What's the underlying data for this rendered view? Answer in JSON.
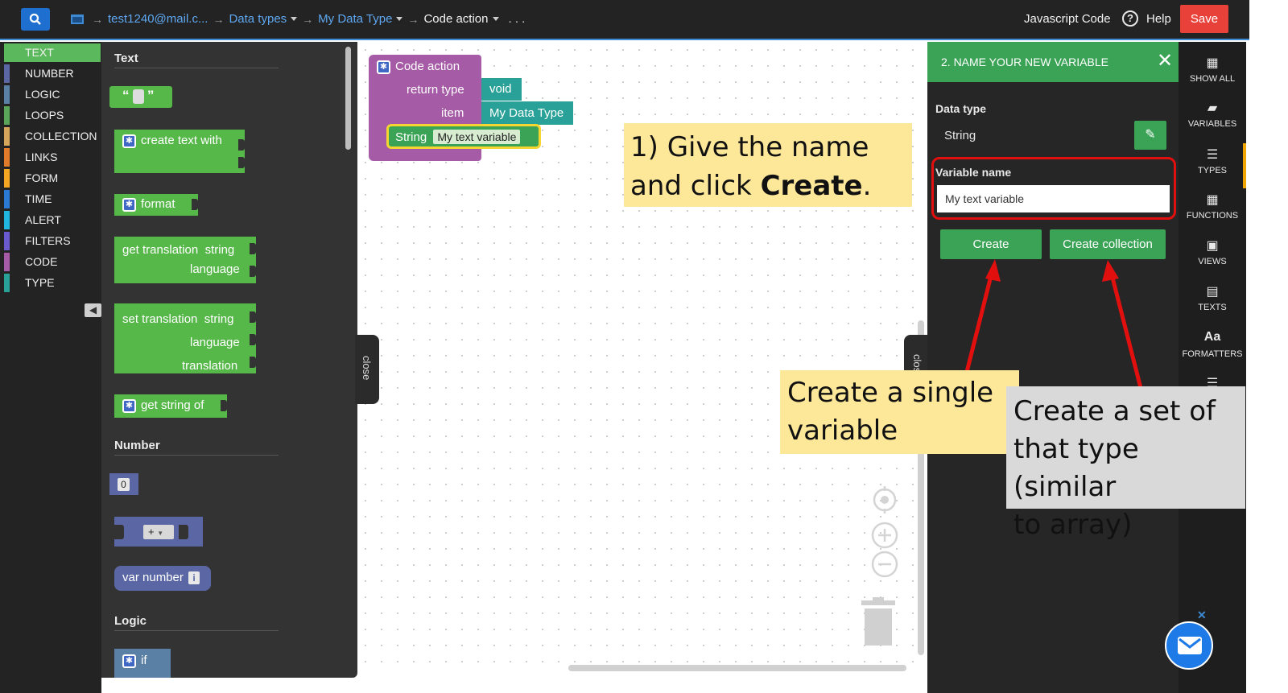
{
  "topbar": {
    "breadcrumbs": [
      "test1240@mail.c...",
      "Data types",
      "My Data Type",
      "Code action"
    ],
    "more": ". . .",
    "js_code": "Javascript Code",
    "help": "Help",
    "save": "Save"
  },
  "categories": [
    {
      "label": "TEXT",
      "color": "#5cb85c"
    },
    {
      "label": "NUMBER",
      "color": "#5b67a5"
    },
    {
      "label": "LOGIC",
      "color": "#5b80a5"
    },
    {
      "label": "LOOPS",
      "color": "#5ba55b"
    },
    {
      "label": "COLLECTION",
      "color": "#d4a55a"
    },
    {
      "label": "LINKS",
      "color": "#e07b2b"
    },
    {
      "label": "FORM",
      "color": "#f5a623"
    },
    {
      "label": "TIME",
      "color": "#2a7ad4"
    },
    {
      "label": "ALERT",
      "color": "#20b6e0"
    },
    {
      "label": "FILTERS",
      "color": "#6a5acd"
    },
    {
      "label": "CODE",
      "color": "#a55ba5"
    },
    {
      "label": "TYPE",
      "color": "#2aa198"
    }
  ],
  "flyout": {
    "text_header": "Text",
    "number_header": "Number",
    "logic_header": "Logic",
    "quote_open": "“",
    "quote_close": "”",
    "create_text_with": "create text with",
    "format": "format",
    "get_translation": "get translation",
    "string": "string",
    "language": "language",
    "set_translation": "set translation",
    "translation": "translation",
    "get_string_of": "get string of",
    "num_zero": "0",
    "op_plus": "+",
    "var_number": "var number",
    "info": "i",
    "if": "if"
  },
  "canvas": {
    "code_action": "Code action",
    "return_type": "return type",
    "void": "void",
    "item": "item",
    "my_data_type": "My Data Type",
    "string": "String",
    "var_name": "My text variable",
    "close_left": "close",
    "close_right": "close"
  },
  "callouts": {
    "c1_line1": "1) Give the name",
    "c1_line2_pre": "and click ",
    "c1_line2_bold": "Create",
    "c1_line2_post": ".",
    "c2_line1": "Create a single",
    "c2_line2": "variable",
    "c3_line1": "Create a set of",
    "c3_line2": "that type (similar",
    "c3_line3": "to array)"
  },
  "panel": {
    "title": "2. NAME YOUR NEW VARIABLE",
    "data_type_label": "Data type",
    "data_type_value": "String",
    "variable_name_label": "Variable name",
    "variable_name_value": "My text variable",
    "create": "Create",
    "create_collection": "Create collection"
  },
  "rail": {
    "show_all": "SHOW ALL",
    "variables": "VARIABLES",
    "types": "TYPES",
    "functions": "FUNCTIONS",
    "views": "VIEWS",
    "texts": "TEXTS",
    "formatters": "FORMATTERS",
    "formatters_icon": "Aa"
  },
  "colors": {
    "accent_green": "#3aa356",
    "save_red": "#e8413a",
    "highlight_red": "#e20f0f",
    "link_blue": "#5ea7f0"
  }
}
